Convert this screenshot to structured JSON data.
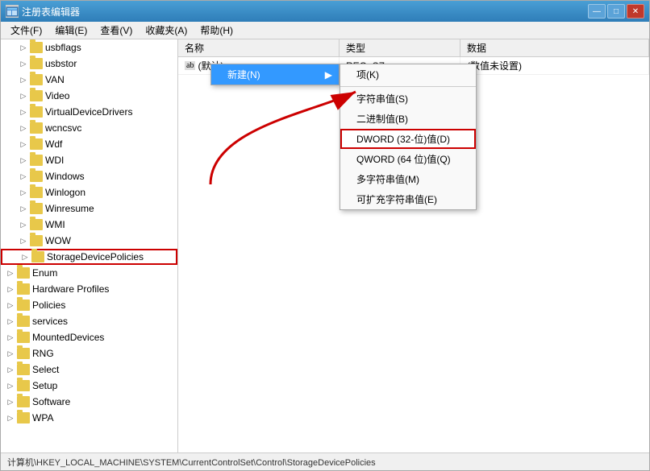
{
  "window": {
    "title": "注册表编辑器",
    "icon": "regedit-icon"
  },
  "menubar": {
    "items": [
      {
        "label": "文件(F)"
      },
      {
        "label": "编辑(E)"
      },
      {
        "label": "查看(V)"
      },
      {
        "label": "收藏夹(A)"
      },
      {
        "label": "帮助(H)"
      }
    ]
  },
  "tree": {
    "items": [
      {
        "label": "usbflags",
        "level": 2,
        "expanded": false
      },
      {
        "label": "usbstor",
        "level": 2,
        "expanded": false
      },
      {
        "label": "VAN",
        "level": 2,
        "expanded": false
      },
      {
        "label": "Video",
        "level": 2,
        "expanded": false
      },
      {
        "label": "VirtualDeviceDrivers",
        "level": 2,
        "expanded": false
      },
      {
        "label": "wcncsvc",
        "level": 2,
        "expanded": false
      },
      {
        "label": "Wdf",
        "level": 2,
        "expanded": false
      },
      {
        "label": "WDI",
        "level": 2,
        "expanded": false
      },
      {
        "label": "Windows",
        "level": 2,
        "expanded": false
      },
      {
        "label": "Winlogon",
        "level": 2,
        "expanded": false
      },
      {
        "label": "Winresume",
        "level": 2,
        "expanded": false
      },
      {
        "label": "WMI",
        "level": 2,
        "expanded": false
      },
      {
        "label": "WOW",
        "level": 2,
        "expanded": false
      },
      {
        "label": "StorageDevicePolicies",
        "level": 2,
        "expanded": false,
        "highlighted": true
      },
      {
        "label": "Enum",
        "level": 1,
        "expanded": false
      },
      {
        "label": "Hardware Profiles",
        "level": 1,
        "expanded": false
      },
      {
        "label": "Policies",
        "level": 1,
        "expanded": false
      },
      {
        "label": "services",
        "level": 1,
        "expanded": false
      },
      {
        "label": "MountedDevices",
        "level": 0,
        "expanded": false
      },
      {
        "label": "RNG",
        "level": 0,
        "expanded": false
      },
      {
        "label": "Select",
        "level": 0,
        "expanded": false
      },
      {
        "label": "Setup",
        "level": 0,
        "expanded": false
      },
      {
        "label": "Software",
        "level": 0,
        "expanded": false
      },
      {
        "label": "WPA",
        "level": 0,
        "expanded": false
      }
    ]
  },
  "table": {
    "columns": [
      "名称",
      "类型",
      "数据"
    ],
    "rows": [
      {
        "name": "(默认)",
        "type": "REG_SZ",
        "data": "(数值未设置)",
        "icon": "ab"
      }
    ]
  },
  "context_menu": {
    "new_label": "新建(N)",
    "arrow": "▶",
    "items": [
      {
        "label": "项(K)"
      },
      {
        "label": "字符串值(S)"
      },
      {
        "label": "二进制值(B)"
      },
      {
        "label": "DWORD (32-位)值(D)",
        "highlighted": true
      },
      {
        "label": "QWORD (64 位)值(Q)"
      },
      {
        "label": "多字符串值(M)"
      },
      {
        "label": "可扩充字符串值(E)"
      }
    ]
  },
  "status_bar": {
    "text": "计算机\\HKEY_LOCAL_MACHINE\\SYSTEM\\CurrentControlSet\\Control\\StorageDevicePolicies"
  },
  "title_buttons": {
    "minimize": "—",
    "maximize": "□",
    "close": "✕"
  }
}
